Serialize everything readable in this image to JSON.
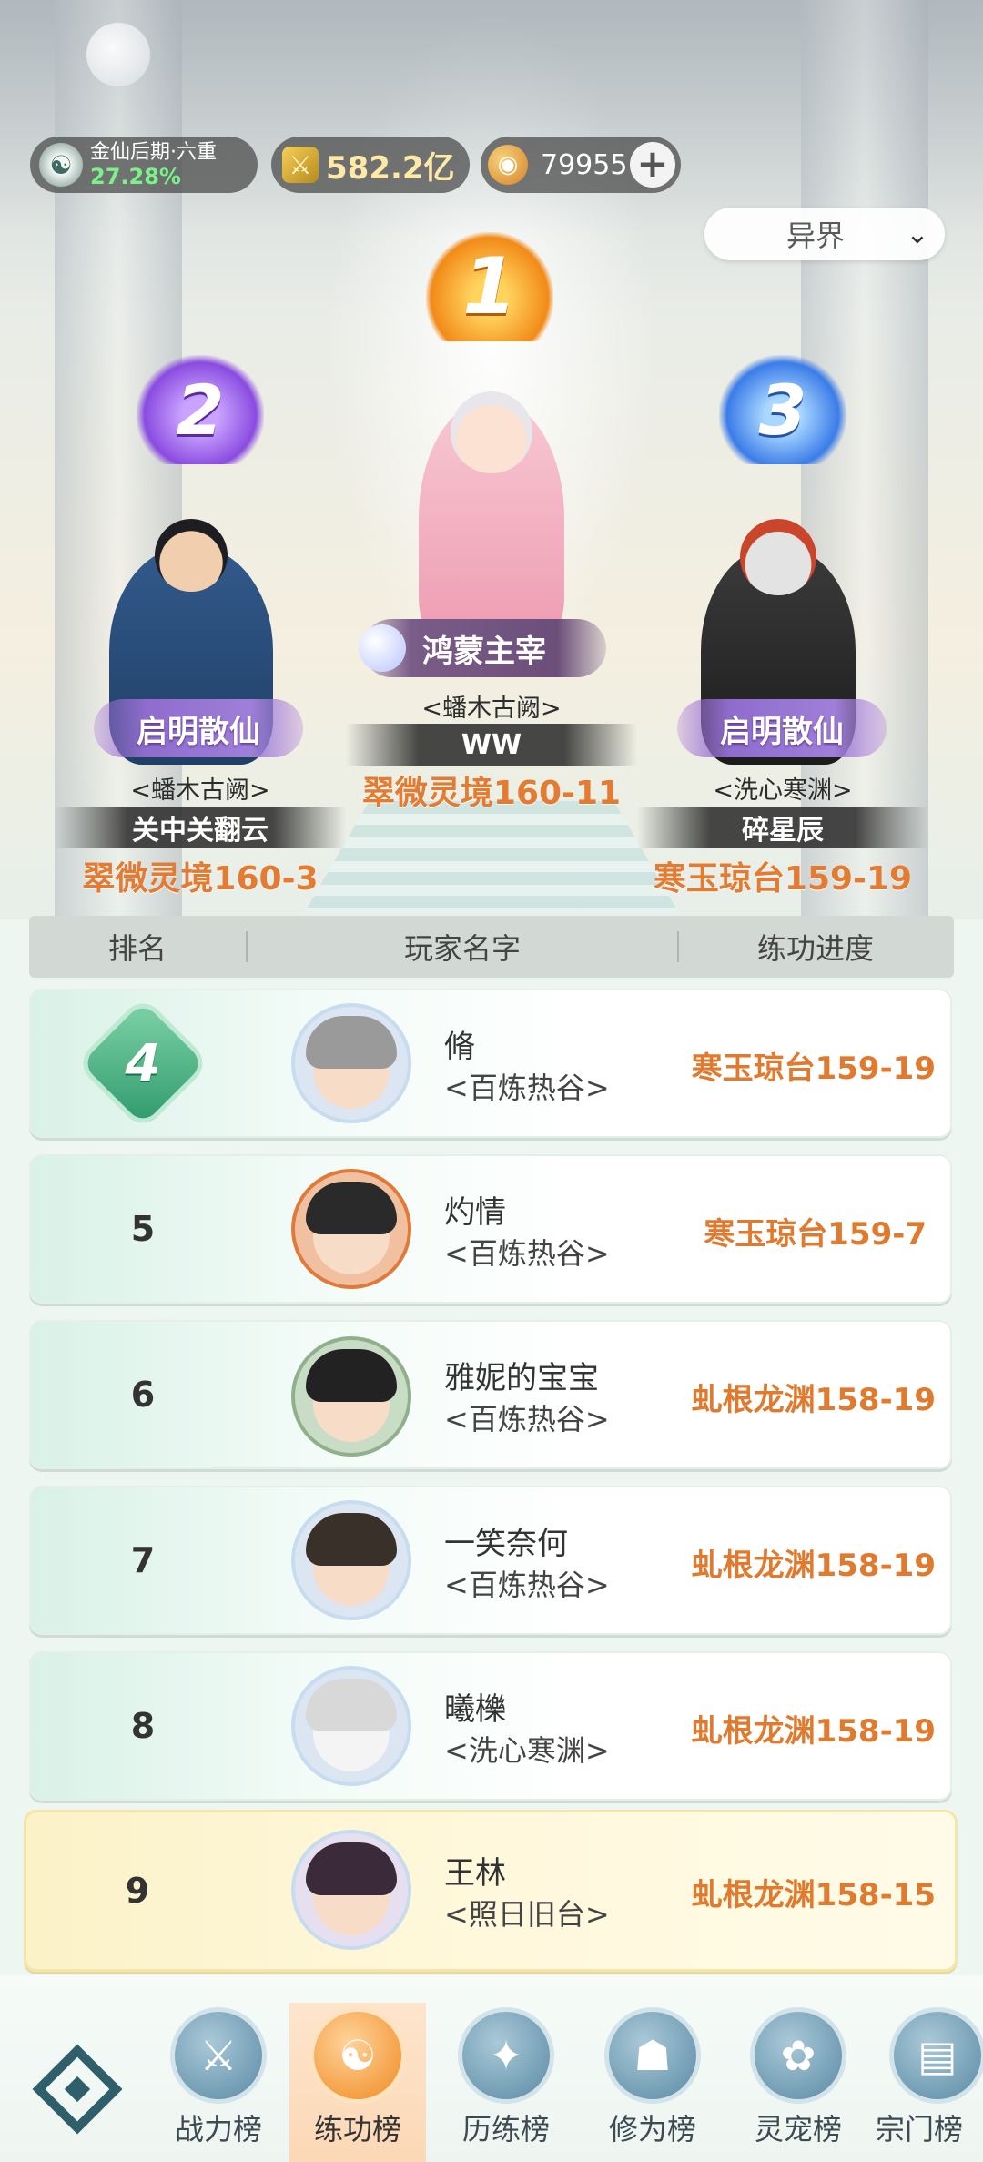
{
  "hud": {
    "realm_title": "金仙后期·六重",
    "realm_percent": "27.28%",
    "power": "582.2亿",
    "coins": "79955",
    "plus": "+",
    "realm_dropdown": "异界"
  },
  "podium": {
    "first": {
      "rank": "1",
      "title": "鸿蒙主宰",
      "guild": "<蟠木古阙>",
      "name": "WW",
      "progress": "翠微灵境160-11"
    },
    "second": {
      "rank": "2",
      "title": "启明散仙",
      "guild": "<蟠木古阙>",
      "name": "关中关翻云",
      "progress": "翠微灵境160-3"
    },
    "third": {
      "rank": "3",
      "title": "启明散仙",
      "guild": "<洗心寒渊>",
      "name": "碎星辰",
      "progress": "寒玉琼台159-19"
    }
  },
  "table": {
    "headers": [
      "排名",
      "玩家名字",
      "练功进度"
    ],
    "rows": [
      {
        "rank": "4",
        "name": "脩",
        "guild": "<百炼热谷>",
        "progress": "寒玉琼台159-19"
      },
      {
        "rank": "5",
        "name": "灼情",
        "guild": "<百炼热谷>",
        "progress": "寒玉琼台159-7"
      },
      {
        "rank": "6",
        "name": "雅妮的宝宝",
        "guild": "<百炼热谷>",
        "progress": "虬根龙渊158-19"
      },
      {
        "rank": "7",
        "name": "一笑奈何",
        "guild": "<百炼热谷>",
        "progress": "虬根龙渊158-19"
      },
      {
        "rank": "8",
        "name": "曦櫟",
        "guild": "<洗心寒渊>",
        "progress": "虬根龙渊158-19"
      }
    ],
    "self_row": {
      "rank": "9",
      "name": "王林",
      "guild": "<照日旧台>",
      "progress": "虬根龙渊158-15"
    }
  },
  "nav": {
    "items": [
      {
        "label": "战力榜",
        "icon": "sword-icon"
      },
      {
        "label": "练功榜",
        "icon": "yin-yang-icon"
      },
      {
        "label": "历练榜",
        "icon": "star-icon"
      },
      {
        "label": "修为榜",
        "icon": "hat-icon"
      },
      {
        "label": "灵宠榜",
        "icon": "pet-icon"
      },
      {
        "label": "宗门榜",
        "icon": "sect-icon"
      }
    ]
  },
  "colors": {
    "progress": "#e07a2e",
    "accent_gold": "#f28a18",
    "self_row": "#fff8dc"
  }
}
